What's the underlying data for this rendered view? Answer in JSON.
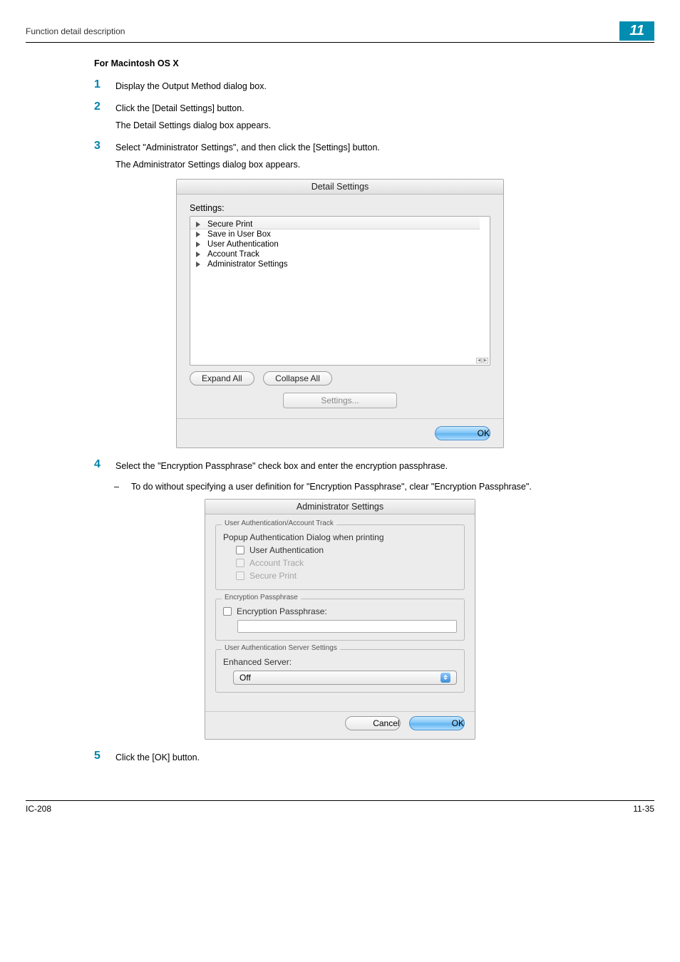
{
  "header": {
    "section_label": "Function detail description",
    "chapter_number": "11"
  },
  "section_title": "For Macintosh OS X",
  "steps": {
    "1": {
      "num": "1",
      "text": "Display the Output Method dialog box."
    },
    "2": {
      "num": "2",
      "text1": "Click the [Detail Settings] button.",
      "text2": "The Detail Settings dialog box appears."
    },
    "3": {
      "num": "3",
      "text1": "Select \"Administrator Settings\", and then click the [Settings] button.",
      "text2": "The Administrator Settings dialog box appears."
    },
    "4": {
      "num": "4",
      "text": "Select the \"Encryption Passphrase\" check box and enter the encryption passphrase.",
      "sub": "To do without specifying a user definition for \"Encryption Passphrase\", clear \"Encryption Passphrase\"."
    },
    "5": {
      "num": "5",
      "text": "Click the [OK] button."
    }
  },
  "detail_dialog": {
    "title": "Detail Settings",
    "settings_label": "Settings:",
    "items": [
      "Secure Print",
      "Save in User Box",
      "User Authentication",
      "Account Track",
      "Administrator Settings"
    ],
    "expand_all": "Expand All",
    "collapse_all": "Collapse All",
    "settings_btn": "Settings...",
    "ok": "OK"
  },
  "admin_dialog": {
    "title": "Administrator Settings",
    "group1_legend": "User Authentication/Account Track",
    "popup_line": "Popup Authentication Dialog when printing",
    "user_auth": "User Authentication",
    "account_track": "Account Track",
    "secure_print": "Secure Print",
    "group2_legend": "Encryption Passphrase",
    "enc_passphrase": "Encryption Passphrase:",
    "group3_legend": "User Authentication Server Settings",
    "enhanced_server_label": "Enhanced Server:",
    "enhanced_server_value": "Off",
    "cancel": "Cancel",
    "ok": "OK"
  },
  "footer": {
    "left": "IC-208",
    "right": "11-35"
  }
}
